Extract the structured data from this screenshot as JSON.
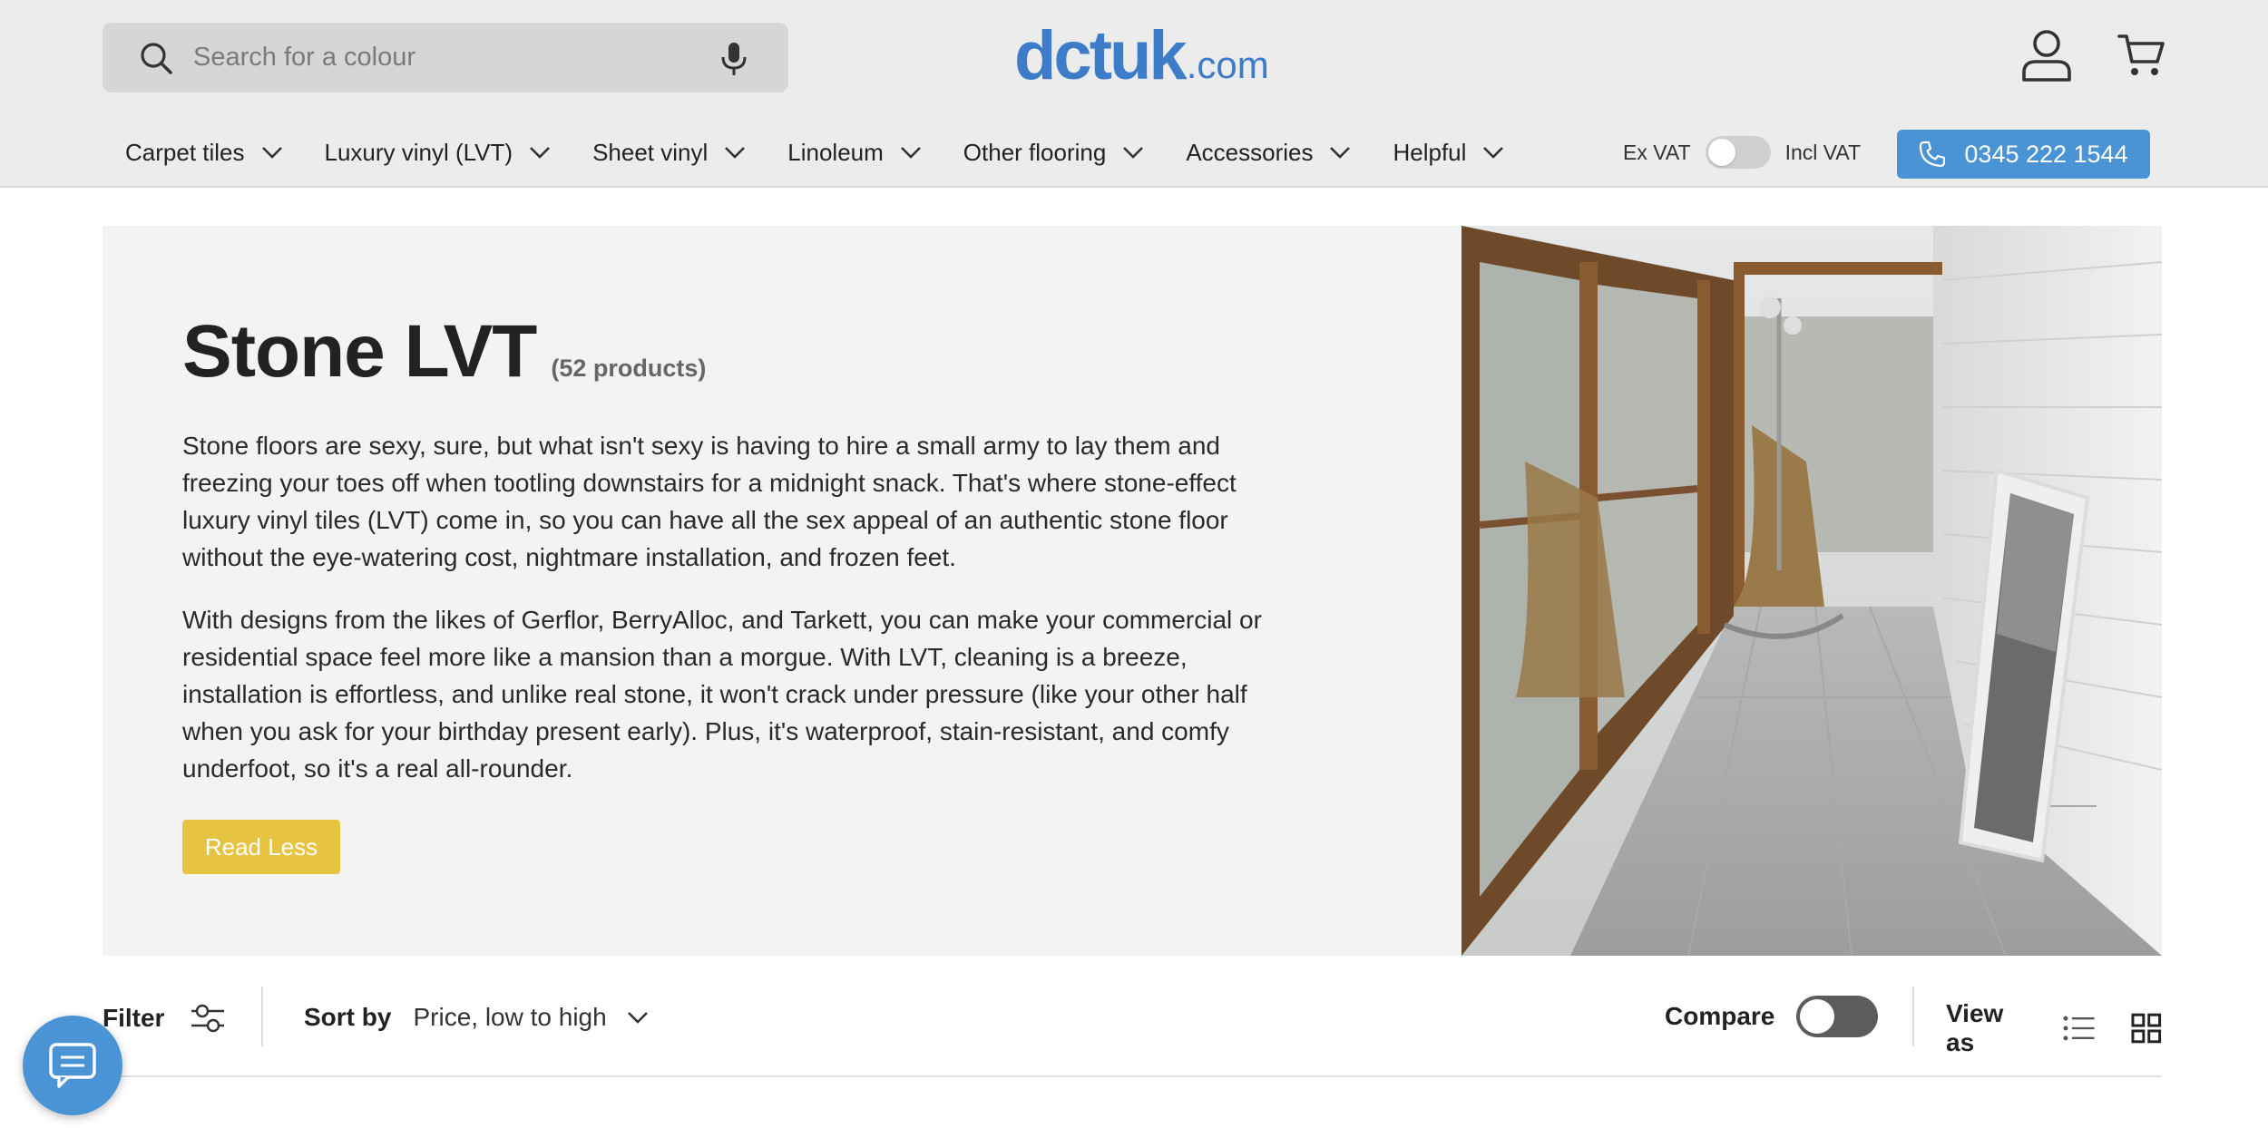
{
  "header": {
    "search": {
      "placeholder": "Search for a colour"
    },
    "logo": {
      "main": "dctuk",
      "tld": ".com"
    },
    "nav": [
      {
        "label": "Carpet tiles"
      },
      {
        "label": "Luxury vinyl (LVT)"
      },
      {
        "label": "Sheet vinyl"
      },
      {
        "label": "Linoleum"
      },
      {
        "label": "Other flooring"
      },
      {
        "label": "Accessories"
      },
      {
        "label": "Helpful"
      }
    ],
    "vat": {
      "ex_label": "Ex VAT",
      "incl_label": "Incl VAT",
      "incl_on": false
    },
    "phone": "0345 222 1544"
  },
  "hero": {
    "title": "Stone LVT",
    "count": "(52 products)",
    "paragraphs": [
      "Stone floors are sexy, sure, but what isn't sexy is having to hire a small army to lay them and freezing your toes off when tootling downstairs for a midnight snack. That's where stone-effect luxury vinyl tiles (LVT) come in, so you can have all the sex appeal of an authentic stone floor without the eye-watering cost, nightmare installation, and frozen feet.",
      "With designs from the likes of Gerflor, BerryAlloc, and Tarkett, you can make your commercial or residential space feel more like a mansion than a morgue. With LVT, cleaning is a breeze, installation is effortless, and unlike real stone, it won't crack under pressure (like your other half when you ask for your birthday present early). Plus, it's waterproof, stain-resistant, and comfy underfoot, so it's a real all-rounder."
    ],
    "read_less": "Read Less"
  },
  "toolbar": {
    "filter": "Filter",
    "sort_label": "Sort by",
    "sort_value": "Price, low to high",
    "compare": "Compare",
    "compare_on": false,
    "view_as": "View as"
  },
  "colors": {
    "header_bg": "#ececec",
    "brand_blue": "#3d7cc9",
    "phone_button": "#4a93d4",
    "read_less_button": "#e6c341",
    "hero_bg": "#f3f3f3"
  },
  "icons": [
    "search-icon",
    "microphone-icon",
    "account-icon",
    "cart-icon",
    "chevron-down-icon",
    "phone-icon",
    "filter-icon",
    "list-view-icon",
    "grid-view-icon",
    "chat-icon"
  ]
}
